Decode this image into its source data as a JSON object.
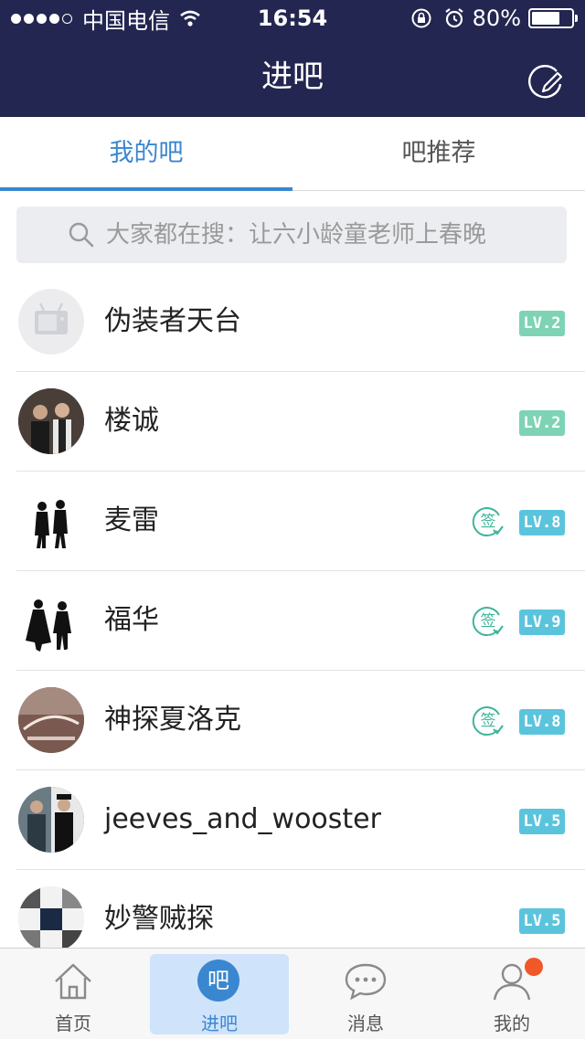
{
  "status_bar": {
    "carrier": "中国电信",
    "time": "16:54",
    "battery": "80%",
    "battery_level": 0.8
  },
  "header": {
    "title": "进吧",
    "edit_icon": "edit-icon"
  },
  "tabs": [
    {
      "label": "我的吧",
      "active": true
    },
    {
      "label": "吧推荐",
      "active": false
    }
  ],
  "search": {
    "placeholder": "大家都在搜：让六小龄童老师上春晚"
  },
  "forums": [
    {
      "name": "伪装者天台",
      "level": "LV.2",
      "signed": false,
      "level_color": "#7ed3b4"
    },
    {
      "name": "楼诚",
      "level": "LV.2",
      "signed": false,
      "level_color": "#7ed3b4"
    },
    {
      "name": "麦雷",
      "level": "LV.8",
      "signed": true,
      "level_color": "#5bc4dd"
    },
    {
      "name": "福华",
      "level": "LV.9",
      "signed": true,
      "level_color": "#5bc4dd"
    },
    {
      "name": "神探夏洛克",
      "level": "LV.8",
      "signed": true,
      "level_color": "#5bc4dd"
    },
    {
      "name": "jeeves_and_wooster",
      "level": "LV.5",
      "signed": false,
      "level_color": "#5bc4dd"
    },
    {
      "name": "妙警贼探",
      "level": "LV.5",
      "signed": false,
      "level_color": "#5bc4dd"
    }
  ],
  "sign_label": "签",
  "bottom_nav": [
    {
      "label": "首页",
      "icon": "home-icon"
    },
    {
      "label": "进吧",
      "icon": "forum-icon",
      "icon_text": "吧",
      "active": true
    },
    {
      "label": "消息",
      "icon": "message-icon"
    },
    {
      "label": "我的",
      "icon": "profile-icon",
      "badge": true
    }
  ],
  "colors": {
    "header_bg": "#232650",
    "accent": "#3a87d0",
    "badge": "#f0582a"
  }
}
